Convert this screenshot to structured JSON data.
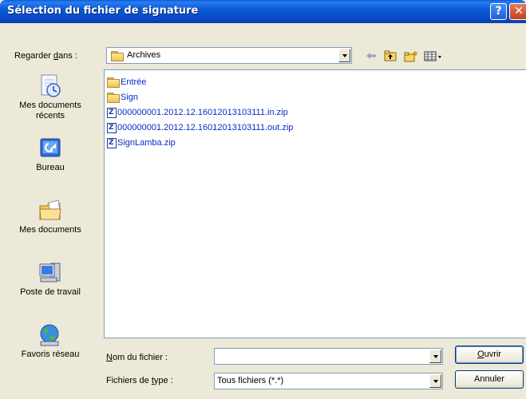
{
  "window": {
    "title": "Sélection du fichier de signature",
    "help_glyph": "?",
    "close_glyph": "✕"
  },
  "lookin": {
    "label_prefix": "Regarder ",
    "label_accel": "d",
    "label_suffix": "ans :",
    "value": "Archives"
  },
  "toolbar": {
    "back_icon": "back-arrow-icon",
    "up_icon": "up-one-level-icon",
    "new_folder_icon": "new-folder-icon",
    "views_icon": "views-menu-icon"
  },
  "places": [
    {
      "id": "recent",
      "label": "Mes documents récents",
      "icon": "recent-documents-icon"
    },
    {
      "id": "desktop",
      "label": "Bureau",
      "icon": "desktop-icon"
    },
    {
      "id": "mydocs",
      "label": "Mes documents",
      "icon": "my-documents-icon"
    },
    {
      "id": "mycomputer",
      "label": "Poste de travail",
      "icon": "my-computer-icon"
    },
    {
      "id": "network",
      "label": "Favoris réseau",
      "icon": "network-places-icon"
    }
  ],
  "files": [
    {
      "name": "Entrée",
      "type": "folder"
    },
    {
      "name": "Sign",
      "type": "folder"
    },
    {
      "name": "000000001.2012.12.16012013103111.in.zip",
      "type": "zip"
    },
    {
      "name": "000000001.2012.12.16012013103111.out.zip",
      "type": "zip"
    },
    {
      "name": "SignLamba.zip",
      "type": "zip"
    }
  ],
  "filename": {
    "label_accel": "N",
    "label_rest": "om du fichier :",
    "value": ""
  },
  "filetype": {
    "label_prefix": "Fichiers de ",
    "label_accel": "t",
    "label_rest": "ype :",
    "value": "Tous fichiers (*.*)"
  },
  "buttons": {
    "open_accel": "O",
    "open_rest": "uvrir",
    "cancel": "Annuler"
  },
  "colors": {
    "titlebar": "#0a58d6",
    "dialog_bg": "#ece9d8",
    "file_text": "#0a2bc7",
    "field_border": "#7f9db9"
  }
}
